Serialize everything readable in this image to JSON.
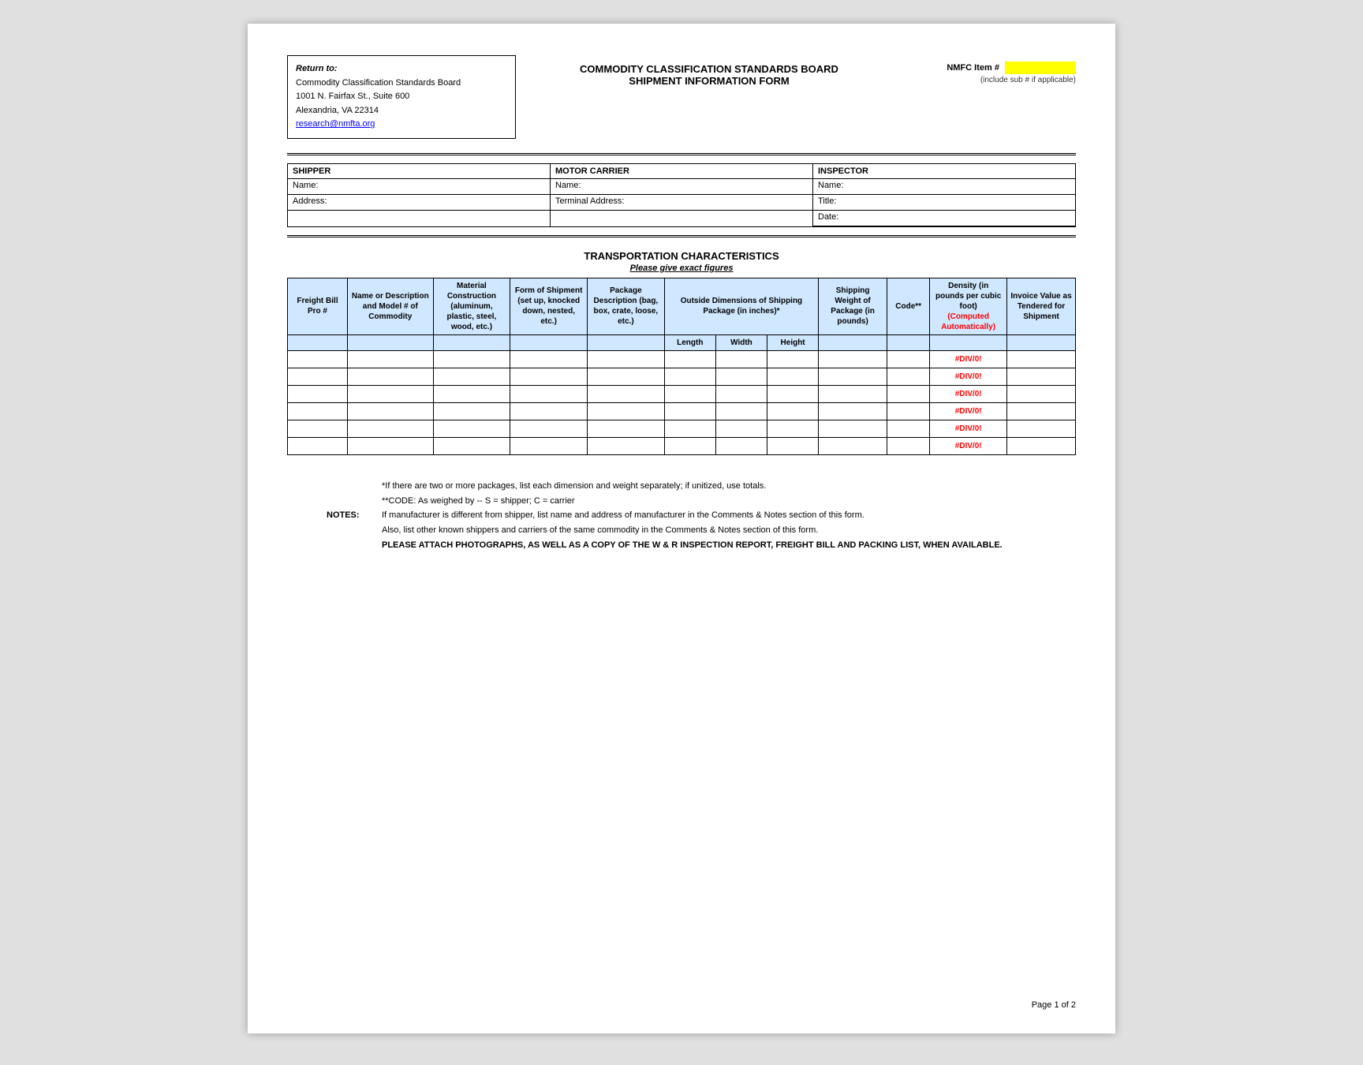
{
  "header": {
    "return_to_label": "Return to:",
    "return_org": "Commodity Classification Standards Board",
    "return_address1": "1001 N. Fairfax St., Suite 600",
    "return_address2": "Alexandria, VA 22314",
    "return_email": "research@nmfta.org",
    "center_line1": "COMMODITY CLASSIFICATION STANDARDS BOARD",
    "center_line2": "SHIPMENT INFORMATION FORM",
    "nmfc_label": "NMFC Item #",
    "nmfc_sub": "(include sub # if applicable)"
  },
  "shipper": {
    "header": "SHIPPER",
    "name_label": "Name:",
    "name_value": "",
    "address_label": "Address:",
    "address_value": "",
    "blank_value": ""
  },
  "motor_carrier": {
    "header": "MOTOR CARRIER",
    "name_label": "Name:",
    "name_value": "",
    "terminal_label": "Terminal Address:",
    "terminal_value": "",
    "blank_value": ""
  },
  "inspector": {
    "header": "INSPECTOR",
    "name_label": "Name:",
    "name_value": "",
    "title_label": "Title:",
    "title_value": "",
    "date_label": "Date:",
    "date_value": ""
  },
  "transport": {
    "title": "TRANSPORTATION CHARACTERISTICS",
    "subtitle_pre": "Please give ",
    "subtitle_exact": "exact",
    "subtitle_post": " figures"
  },
  "table": {
    "headers": {
      "freight_bill": "Freight Bill Pro #",
      "name_desc": "Name or Description and Model # of Commodity",
      "material": "Material Construction (aluminum, plastic, steel, wood, etc.)",
      "form": "Form of Shipment (set up, knocked down, nested, etc.)",
      "package_desc": "Package Description (bag, box, crate, loose, etc.)",
      "outside_dim": "Outside Dimensions of Shipping Package (in inches)*",
      "length": "Length",
      "width": "Width",
      "height": "Height",
      "shipping_weight": "Shipping Weight of Package (in pounds)",
      "code": "Code**",
      "density": "Density (in pounds per cubic foot)",
      "density_sub": "(Computed Automatically)",
      "invoice_value": "Invoice Value as Tendered for Shipment"
    },
    "rows": [
      {
        "freight_bill": "",
        "name": "",
        "material": "",
        "form": "",
        "package": "",
        "length": "",
        "width": "",
        "height": "",
        "weight": "",
        "code": "",
        "density": "#DIV/0!",
        "invoice": ""
      },
      {
        "freight_bill": "",
        "name": "",
        "material": "",
        "form": "",
        "package": "",
        "length": "",
        "width": "",
        "height": "",
        "weight": "",
        "code": "",
        "density": "#DIV/0!",
        "invoice": ""
      },
      {
        "freight_bill": "",
        "name": "",
        "material": "",
        "form": "",
        "package": "",
        "length": "",
        "width": "",
        "height": "",
        "weight": "",
        "code": "",
        "density": "#DIV/0!",
        "invoice": ""
      },
      {
        "freight_bill": "",
        "name": "",
        "material": "",
        "form": "",
        "package": "",
        "length": "",
        "width": "",
        "height": "",
        "weight": "",
        "code": "",
        "density": "#DIV/0!",
        "invoice": ""
      },
      {
        "freight_bill": "",
        "name": "",
        "material": "",
        "form": "",
        "package": "",
        "length": "",
        "width": "",
        "height": "",
        "weight": "",
        "code": "",
        "density": "#DIV/0!",
        "invoice": ""
      },
      {
        "freight_bill": "",
        "name": "",
        "material": "",
        "form": "",
        "package": "",
        "length": "",
        "width": "",
        "height": "",
        "weight": "",
        "code": "",
        "density": "#DIV/0!",
        "invoice": ""
      }
    ]
  },
  "notes": {
    "footnote1": "*If there are two or more packages, list each dimension and weight separately; if unitized, use totals.",
    "footnote2": "**CODE:  As weighed by  --  S = shipper;  C = carrier",
    "notes_label": "NOTES:",
    "note1": "If manufacturer is different from shipper, list name and address of manufacturer in the Comments & Notes section of this form.",
    "note2": "Also, list other known shippers and carriers of the same commodity in the Comments & Notes section of this form.",
    "note3": "PLEASE ATTACH PHOTOGRAPHS, AS WELL AS A COPY OF THE W & R INSPECTION REPORT, FREIGHT BILL AND PACKING LIST, WHEN AVAILABLE."
  },
  "page": {
    "number": "Page 1 of 2"
  }
}
